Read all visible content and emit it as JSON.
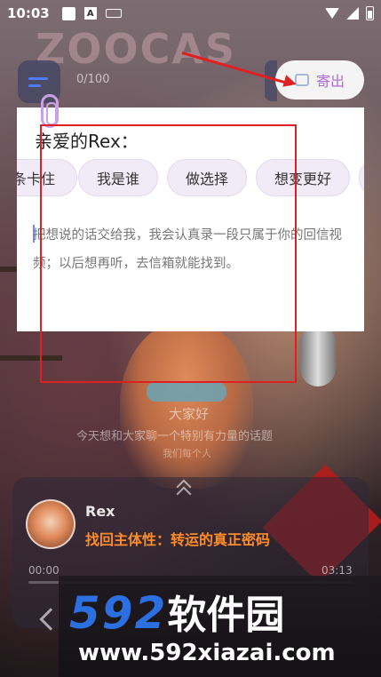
{
  "status_bar": {
    "time": "10:03"
  },
  "header": {
    "counter": "0/100",
    "send_label": "寄出"
  },
  "letter": {
    "greeting": "亲爱的Rex：",
    "chips": [
      "条卡住",
      "我是谁",
      "做选择",
      "想变更好"
    ],
    "placeholder": "把想说的话交给我，我会认真录一段只属于你的回信视频；以后想再听，去信箱就能找到。"
  },
  "overlay": {
    "hello": "大家好",
    "topic": "今天想和大家聊一个特别有力量的话题",
    "everyone": "我们每个人"
  },
  "player": {
    "author": "Rex",
    "episode_title": "找回主体性：转运的真正密码",
    "current_time": "00:00",
    "total_time": "03:13",
    "progress": 0
  },
  "watermark": {
    "brand_number": "592",
    "brand_text": "软件园",
    "url": "www.592xiazai.com"
  },
  "colors": {
    "accent_purple": "#b06bd8",
    "episode_orange": "#ff8c2a",
    "watermark_blue": "#2c6fe0",
    "annotation_red": "#e02020"
  }
}
